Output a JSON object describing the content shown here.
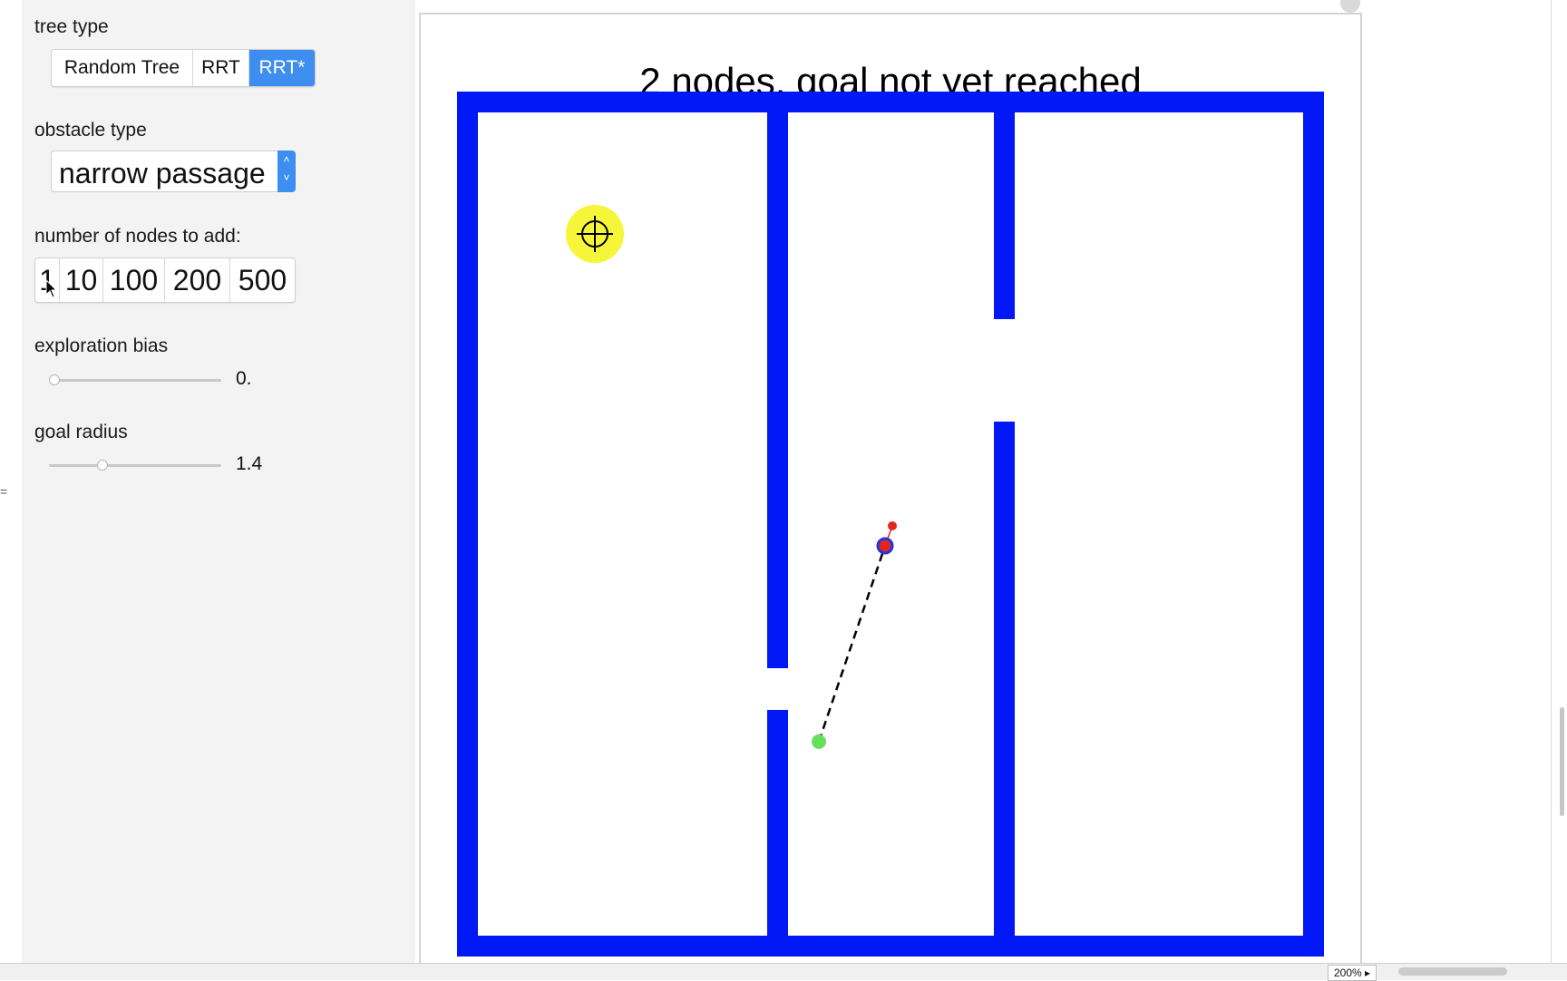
{
  "controls": {
    "tree_type": {
      "label": "tree type",
      "options": [
        "Random Tree",
        "RRT",
        "RRT*"
      ],
      "selected": "RRT*"
    },
    "obstacle_type": {
      "label": "obstacle type",
      "value": "narrow passage"
    },
    "nodes_to_add": {
      "label": "number of nodes to add:",
      "options": [
        "1",
        "10",
        "100",
        "200",
        "500"
      ]
    },
    "exploration_bias": {
      "label": "exploration bias",
      "value_text": "0.",
      "fraction": 0.0
    },
    "goal_radius": {
      "label": "goal radius",
      "value_text": "1.4",
      "fraction": 0.3
    }
  },
  "plot": {
    "title": "2 nodes, goal not yet reached",
    "wall_color": "#0018f5",
    "start_color": "#66e05a",
    "goal_color": "#f5f53a",
    "node_color": "#e0261e",
    "node_ring_color": "#2035e0"
  },
  "status_bar": {
    "zoom": "200%"
  }
}
